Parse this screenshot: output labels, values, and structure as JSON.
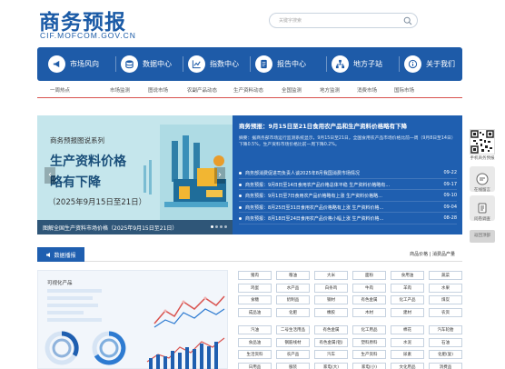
{
  "header": {
    "title": "商务预报",
    "subtitle": "CIF.MOFCOM.GOV.CN",
    "search_placeholder": "关键字搜索"
  },
  "nav": [
    {
      "label": "市场风向",
      "icon": "megaphone-icon"
    },
    {
      "label": "数据中心",
      "icon": "database-icon"
    },
    {
      "label": "指数中心",
      "icon": "line-chart-icon"
    },
    {
      "label": "报告中心",
      "icon": "document-icon"
    },
    {
      "label": "地方子站",
      "icon": "map-network-icon"
    },
    {
      "label": "关于我们",
      "icon": "info-icon"
    }
  ],
  "subnav": [
    "一周热点",
    "市场监测",
    "图说市场",
    "农副产品动态",
    "生产资料动态",
    "全国监测",
    "地方监测",
    "消费市场",
    "国际市场"
  ],
  "slider": {
    "tag": "商务预报图说系列",
    "line1": "生产资料价格",
    "line2": "略有下降",
    "date": "（2025年9月15日至21日）",
    "caption": "图解全国生产资料市场价格（2025年9月15日至21日）",
    "prev": "‹",
    "next": "›"
  },
  "news": {
    "headline": "商务预报：9月15日至21日食用农产品和生产资料价格略有下降",
    "summary": "摘要：据商务部市场运行监测系统显示，9月15日至21日，全国食用农产品市场价格比前一周（9月8日至14日）下降0.5%，生产资料市场价格比前一周下降0.2%。",
    "items": [
      {
        "title": "商务部消费促进司负责人谈2025年8月我国消费市场情况",
        "date": "09-22"
      },
      {
        "title": "商务预报：9月8日至14日食用农产品价格总体平稳 生产资料价格略有...",
        "date": "09-17"
      },
      {
        "title": "商务预报：9月1日至7日食用农产品价格略有上涨 生产资料价格略...",
        "date": "09-10"
      },
      {
        "title": "商务预报：8月25日至31日食用农产品价格略有上涨 生产资料价格...",
        "date": "09-04"
      },
      {
        "title": "商务预报：8月18日至24日食用农产品价格小幅上涨 生产资料价格...",
        "date": "08-28"
      }
    ]
  },
  "sidebar": {
    "qr_label": "手机商务预报",
    "btn1_label": "在线留言",
    "btn2_label": "问卷调查",
    "top_label": "返回顶部"
  },
  "section": {
    "tab": "数据播报",
    "right": "商品价格 | 消费品产量"
  },
  "chart_card": {
    "label": "可视化产品"
  },
  "tags": [
    "猪肉",
    "粮油",
    "大米",
    "面粉",
    "食用油",
    "蔬菜",
    "鸡蛋",
    "水产品",
    "白条鸡",
    "牛肉",
    "羊肉",
    "水果",
    "食糖",
    "奶制品",
    "钢材",
    "有色金属",
    "化工产品",
    "煤炭",
    "成品油",
    "化肥",
    "橡胶",
    "木材",
    "建材",
    "农资",
    "汽油",
    "二号生活用品",
    "有色金属",
    "化工用品",
    "棉花",
    "汽车轮胎",
    "食品油",
    "钢筋线材",
    "有色金属(铝)",
    "塑料原料",
    "水泥",
    "石油",
    "生活资料",
    "农产品",
    "汽车",
    "生产资料",
    "尿素",
    "化肥(复)",
    "日用品",
    "服装",
    "家电(大)",
    "家电(小)",
    "文化用品",
    "消费品"
  ]
}
